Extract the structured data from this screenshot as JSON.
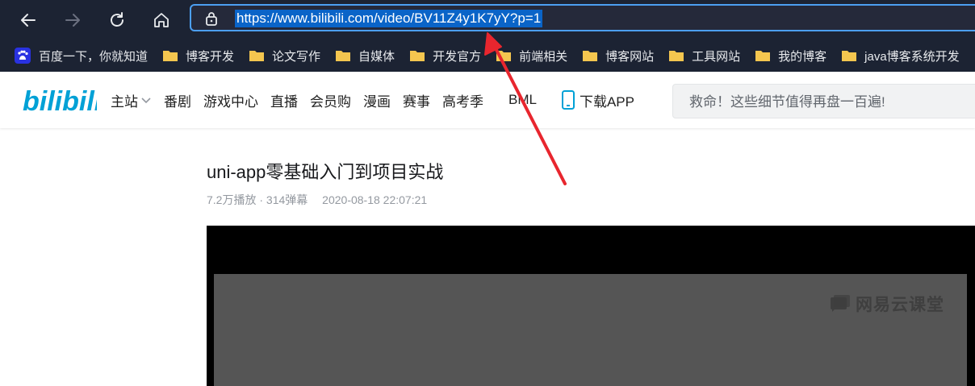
{
  "browser": {
    "url": "https://www.bilibili.com/video/BV11Z4y1K7yY?p=1",
    "nav": {
      "back_icon": "arrow-left-icon",
      "forward_icon": "arrow-right-icon",
      "refresh_icon": "refresh-icon",
      "home_icon": "home-icon",
      "lock_icon": "lock-icon"
    }
  },
  "bookmarks": [
    {
      "label": "百度一下，你就知道",
      "icon": "baidu-icon"
    },
    {
      "label": "博客开发",
      "icon": "folder-icon"
    },
    {
      "label": "论文写作",
      "icon": "folder-icon"
    },
    {
      "label": "自媒体",
      "icon": "folder-icon"
    },
    {
      "label": "开发官方",
      "icon": "folder-icon"
    },
    {
      "label": "前端相关",
      "icon": "folder-icon"
    },
    {
      "label": "博客网站",
      "icon": "folder-icon"
    },
    {
      "label": "工具网站",
      "icon": "folder-icon"
    },
    {
      "label": "我的博客",
      "icon": "folder-icon"
    },
    {
      "label": "java博客系统开发",
      "icon": "folder-icon"
    }
  ],
  "bili": {
    "logo_text": "bilibili",
    "menu": [
      "主站",
      "番剧",
      "游戏中心",
      "直播",
      "会员购",
      "漫画",
      "赛事",
      "高考季"
    ],
    "bml": "BML",
    "download": "下载APP",
    "search_placeholder": "救命！这些细节值得再盘一百遍!"
  },
  "video": {
    "title": "uni-app零基础入门到项目实战",
    "plays": "7.2万播放",
    "separator": "·",
    "danmaku": "314弹幕",
    "date": "2020-08-18 22:07:21",
    "watermark": "网易云课堂"
  },
  "colors": {
    "toolbar_bg": "#1c2333",
    "url_highlight": "#0a64c8",
    "address_border": "#4c9ff2",
    "bili_blue": "#00a1d6",
    "annotation_arrow": "#e8262e"
  }
}
